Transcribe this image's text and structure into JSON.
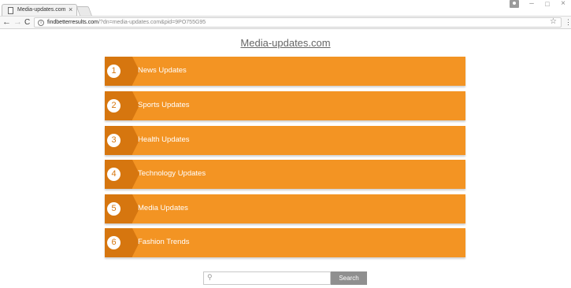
{
  "browser": {
    "tab_title": "Media-updates.com",
    "tab_close": "×",
    "url_host": "findbetterresults.com",
    "url_path": "/?dn=media-updates.com&pid=9PO755G95",
    "info_icon": "i",
    "star_icon": "☆",
    "menu_icon": "⋮",
    "back_icon": "←",
    "forward_icon": "→",
    "reload_icon": "C",
    "minimize_icon": "–",
    "maximize_icon": "□",
    "close_icon": "×"
  },
  "page": {
    "title": "Media-updates.com",
    "items": [
      {
        "number": "1",
        "label": "News Updates"
      },
      {
        "number": "2",
        "label": "Sports Updates"
      },
      {
        "number": "3",
        "label": "Health Updates"
      },
      {
        "number": "4",
        "label": "Technology Updates"
      },
      {
        "number": "5",
        "label": "Media Updates"
      },
      {
        "number": "6",
        "label": "Fashion Trends"
      }
    ],
    "search": {
      "placeholder": "",
      "button_label": "Search",
      "icon": "⚲"
    }
  },
  "colors": {
    "item_background": "#f39423",
    "badge_background": "#d6760f",
    "search_button": "#8f8f8f",
    "title_text": "#666666"
  }
}
